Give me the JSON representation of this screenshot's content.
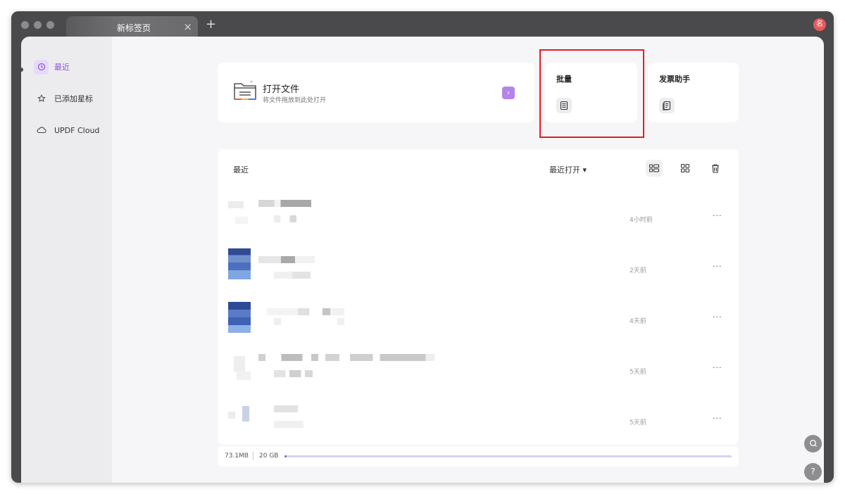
{
  "window": {
    "tab_title": "新标签页",
    "tab_close": "×",
    "tab_add": "+",
    "avatar_label": "名",
    "avatar_color": "#e8595a"
  },
  "sidebar": {
    "items": [
      {
        "label": "最近",
        "icon": "clock-icon",
        "active": true
      },
      {
        "label": "已添加星标",
        "icon": "star-icon",
        "active": false
      },
      {
        "label": "UPDF Cloud",
        "icon": "cloud-icon",
        "active": false
      }
    ]
  },
  "open_file": {
    "title": "打开文件",
    "subtitle": "将文件拖放到此处打开",
    "arrow": "›"
  },
  "batch": {
    "title": "批量",
    "icon": "batch-document-icon"
  },
  "invoice": {
    "title": "发票助手",
    "icon": "invoice-icon"
  },
  "recent": {
    "title": "最近",
    "sort_label": "最近打开 ▾",
    "files": [
      {
        "time": "4小时前",
        "more": "···",
        "thumb": "blank"
      },
      {
        "time": "2天前",
        "more": "···",
        "thumb": "blue"
      },
      {
        "time": "4天前",
        "more": "···",
        "thumb": "blue"
      },
      {
        "time": "5天前",
        "more": "···",
        "thumb": "blank"
      },
      {
        "time": "5天前",
        "more": "···",
        "thumb": "light"
      }
    ]
  },
  "storage": {
    "used": "73.1MB",
    "total": "20 GB",
    "used_fraction": 0.0036
  },
  "floating": {
    "search": "⌕",
    "help": "?"
  },
  "colors": {
    "accent": "#8a56dc",
    "highlight_box": "#e21d23"
  }
}
